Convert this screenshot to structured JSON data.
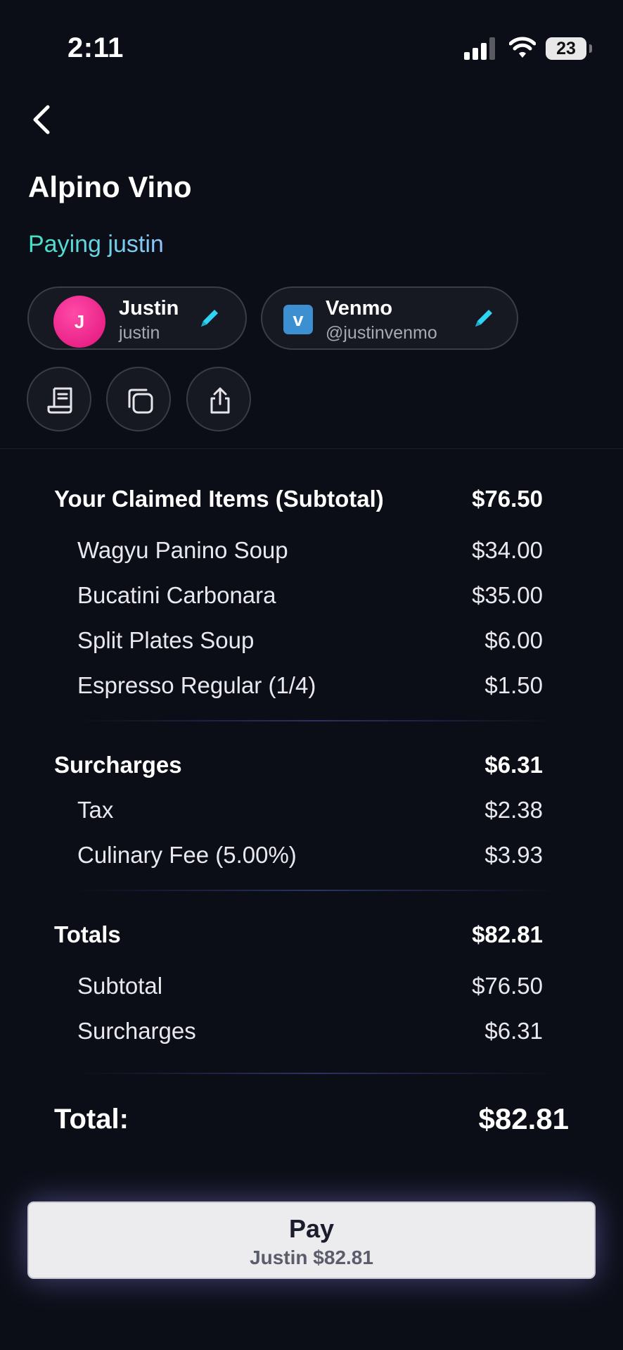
{
  "status_bar": {
    "time": "2:11",
    "battery": "23"
  },
  "header": {
    "back_icon": "chevron-left-icon",
    "restaurant_name": "Alpino Vino",
    "paying_label": "Paying justin"
  },
  "payer_chip": {
    "avatar_initial": "J",
    "name": "Justin",
    "handle": "justin"
  },
  "payment_chip": {
    "logo_letter": "v",
    "name": "Venmo",
    "handle": "@justinvenmo"
  },
  "action_icons": [
    "receipt-icon",
    "copy-icon",
    "share-icon"
  ],
  "claimed": {
    "title": "Your Claimed Items (Subtotal)",
    "amount": "$76.50",
    "items": [
      {
        "label": "Wagyu Panino Soup",
        "amount": "$34.00"
      },
      {
        "label": "Bucatini Carbonara",
        "amount": "$35.00"
      },
      {
        "label": "Split Plates Soup",
        "amount": "$6.00"
      },
      {
        "label": "Espresso Regular (1/4)",
        "amount": "$1.50"
      }
    ]
  },
  "surcharges": {
    "title": "Surcharges",
    "amount": "$6.31",
    "items": [
      {
        "label": "Tax",
        "amount": "$2.38"
      },
      {
        "label": "Culinary Fee (5.00%)",
        "amount": "$3.93"
      }
    ]
  },
  "totals": {
    "title": "Totals",
    "amount": "$82.81",
    "items": [
      {
        "label": "Subtotal",
        "amount": "$76.50"
      },
      {
        "label": "Surcharges",
        "amount": "$6.31"
      }
    ]
  },
  "grand_total": {
    "label": "Total:",
    "amount": "$82.81"
  },
  "pay_button": {
    "title": "Pay",
    "subtitle": "Justin $82.81"
  },
  "colors": {
    "background": "#0c0e17",
    "accent_teal": "#41e2c6",
    "pencil_cyan": "#2fd3f3",
    "avatar_pink": "#e0137a",
    "venmo_blue": "#3c8fd1"
  }
}
